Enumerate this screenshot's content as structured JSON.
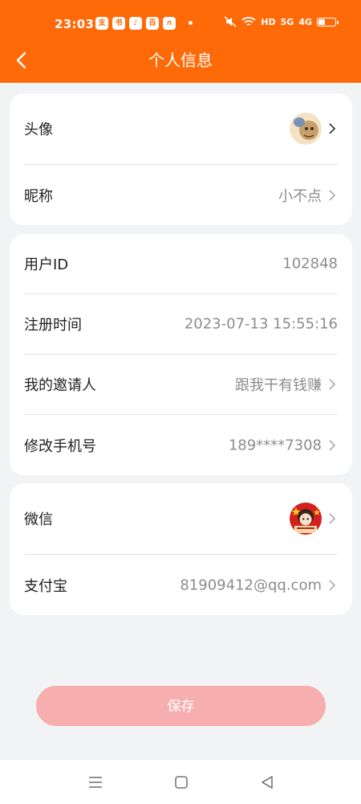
{
  "status_bar": {
    "time": "23:03",
    "app_icons": [
      "支",
      "书",
      "♪",
      "百",
      "∩"
    ],
    "indicators": [
      "HD",
      "5G",
      "4G"
    ]
  },
  "header": {
    "title": "个人信息"
  },
  "sections": {
    "profile": {
      "avatar_label": "头像",
      "nickname_label": "昵称",
      "nickname_value": "小不点"
    },
    "account": {
      "user_id_label": "用户ID",
      "user_id_value": "102848",
      "register_time_label": "注册时间",
      "register_time_value": "2023-07-13 15:55:16",
      "inviter_label": "我的邀请人",
      "inviter_value": "跟我干有钱赚",
      "phone_label": "修改手机号",
      "phone_value": "189****7308"
    },
    "payment": {
      "wechat_label": "微信",
      "alipay_label": "支付宝",
      "alipay_value": "81909412@qq.com"
    }
  },
  "save_button": "保存",
  "colors": {
    "header": "#ff6a08",
    "save_button": "#f6aeae",
    "background": "#f2f3f5"
  }
}
